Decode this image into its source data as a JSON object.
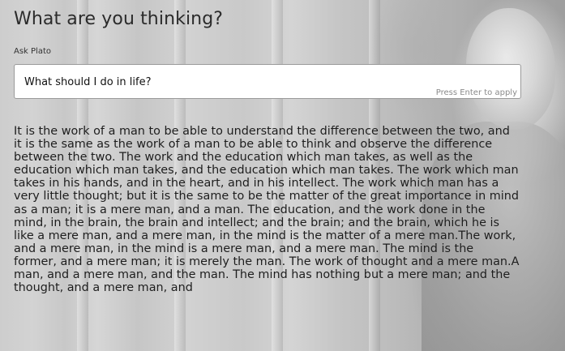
{
  "header": {
    "title": "What are you thinking?"
  },
  "query": {
    "label": "Ask Plato",
    "value": "What should I do in life?",
    "hint": "Press Enter to apply"
  },
  "response": {
    "text": "It is the work of a man to be able to understand the difference between the two, and it is the same as the work of a man to be able to think and observe the difference between the two. The work and the education which man takes, as well as the education which man takes, and the education which man takes. The work which man takes in his hands, and in the heart, and in his intellect. The work which man has a very little thought; but it is the same to be the matter of the great importance in mind as a man; it is a mere man, and a man. The education, and the work done in the mind, in the brain, the brain and intellect; and the brain; and the brain, which he is like a mere man, and a mere man, in the mind is the matter of a mere man.The work, and a mere man, in the mind is a mere man, and a mere man. The mind is the former, and a mere man; it is merely the man. The work of thought and a mere man.A man, and a mere man, and the man. The mind has nothing but a mere man; and the thought, and a mere man, and"
  },
  "background": {
    "subject": "greyscale statue of Plato with columns"
  }
}
